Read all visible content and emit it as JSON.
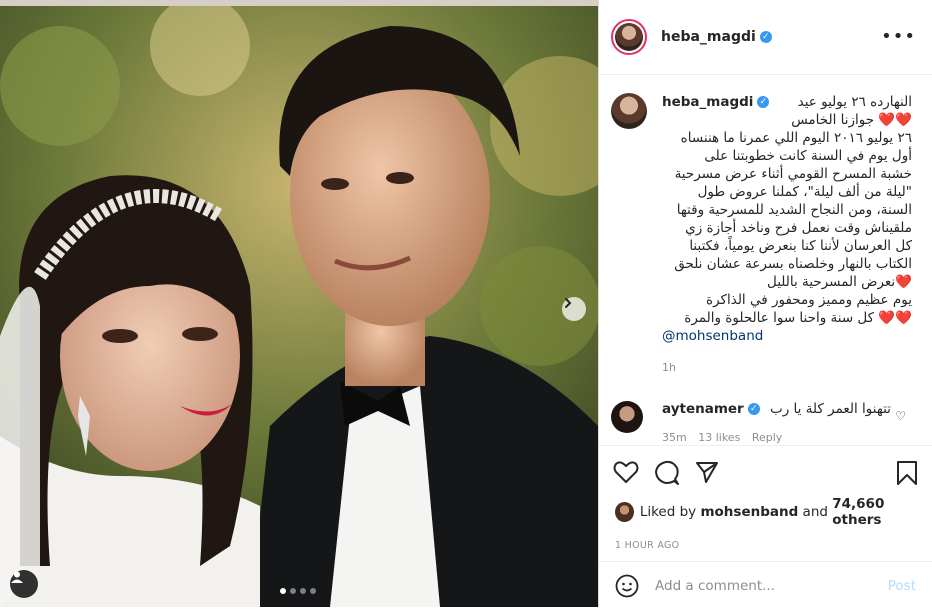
{
  "post": {
    "username": "heba_magdi",
    "verified": true,
    "caption_lines": "النهارده ٢٦ يوليو عيد\n❤️❤️ جوازنا الخامس\n٢٦ يوليو ٢٠١٦ اليوم اللي عمرنا ما هننساه\nأول يوم في السنة كانت خطوبتنا على\nخشبة المسرح القومي أثناء عرض مسرحية\n\"ليلة من ألف ليلة\"، كملنا عروض طول\nالسنة، ومن النجاح الشديد للمسرحية وقتها\nملقيناش وقت نعمل فرح وناخد أجازة زي\nكل العرسان لأننا كنا بنعرض يومياً، فكتبنا\nالكتاب بالنهار وخلصناه بسرعة عشان نلحق\n❤️نعرض المسرحية بالليل\nيوم عظيم ومميز ومحفور في الذاكرة\n❤️❤️ كل سنة واحنا سوا عالحلوة والمرة",
    "mention": "@mohsenband",
    "caption_time": "1h",
    "likes_prefix": "Liked by ",
    "liked_by": "mohsenband",
    "likes_and": " and ",
    "likes_count": "74,660 others",
    "posted_ago": "1 HOUR AGO",
    "add_comment_placeholder": "Add a comment...",
    "post_label": "Post",
    "more_label": "•••"
  },
  "comments": [
    {
      "username": "aytenamer",
      "verified": true,
      "text": "تتهنوا العمر كلة يا رب",
      "age": "35m",
      "likes": "13 likes",
      "reply": "Reply"
    }
  ],
  "carousel": {
    "slides": 4,
    "active": 0
  },
  "colors": {
    "verified": "#3897f0",
    "link": "#00376b",
    "post_disabled": "#b2dffc",
    "ring": "#e1306c"
  },
  "icons": [
    "heart-icon",
    "comment-icon",
    "share-icon",
    "bookmark-icon",
    "emoji-icon",
    "user-tag-icon",
    "chevron-right-icon",
    "more-icon",
    "verified-icon"
  ]
}
